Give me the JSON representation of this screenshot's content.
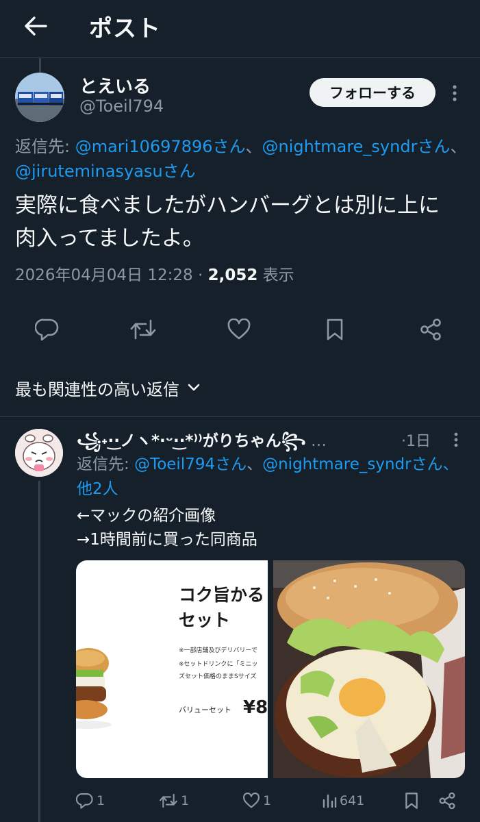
{
  "header": {
    "title": "ポスト"
  },
  "tweet": {
    "name": "とえいる",
    "handle": "@Toeil794",
    "follow_label": "フォローする",
    "reply_to_prefix": "返信先: ",
    "reply_mentions": [
      "@mari10697896さん",
      "@nightmare_syndrさん",
      "@jiruteminasyasuさん"
    ],
    "reply_separator": "、",
    "text_line1": "実際に食べましたがハンバーグとは別に上に",
    "text_line2": "肉入ってましたよ。",
    "timestamp": "2026年04月04日 12:28",
    "dot": " · ",
    "views_count": "2,052",
    "views_label": " 表示"
  },
  "sort": {
    "label": "最も関連性の高い返信"
  },
  "reply": {
    "name": "꧁⁠˖·͜·⁠ノ⁠⁠⁠⁠⁠⁠ヽ⁠*·⁠⁠⁠⁠⁠⁠⁠ᵕ⁠·͜·⁠*⁠⁾⁾がりちゃん꧂",
    "name_ellipsis": " …",
    "time": "·1日",
    "reply_to_prefix": "返信先: ",
    "reply_mention1": "@Toeil794さん",
    "reply_separator": "、",
    "reply_mention2": "@nightmare_syndrさん、他2人",
    "text_line1": "←マックの紹介画像",
    "text_line2": "→1時間前に買った同商品",
    "media_left": {
      "title_line1": "コク旨かる",
      "title_line2": "セット",
      "note1": "※一部店舗及びデリバリーで",
      "note2": "※セットドリンクに「ミニッ",
      "note3": "ズセット価格のままSサイズ",
      "price_label": "バリューセット",
      "price_value": "¥8"
    },
    "stats": {
      "replies": "1",
      "reposts": "1",
      "likes": "1",
      "views": "641"
    }
  }
}
